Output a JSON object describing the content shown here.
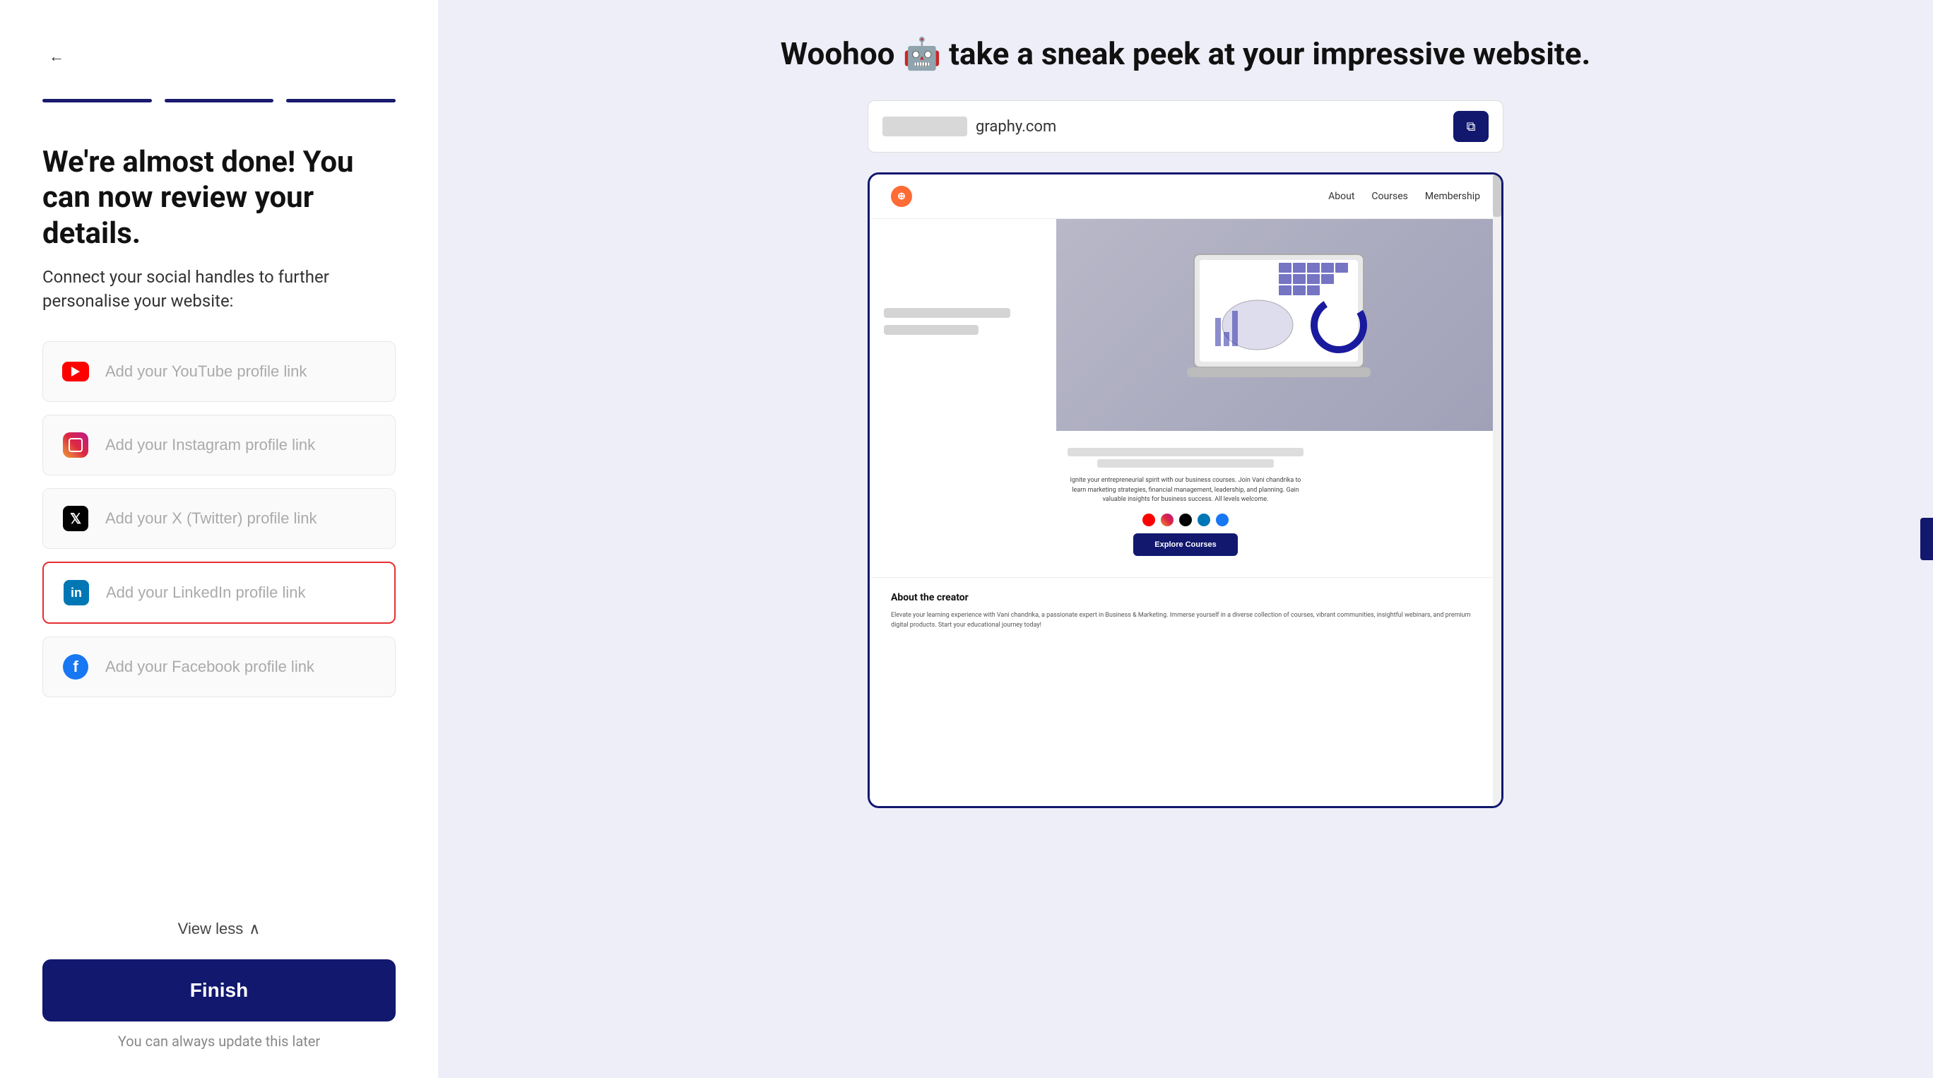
{
  "left": {
    "back_arrow": "←",
    "progress_segments": [
      {
        "active": true
      },
      {
        "active": true
      },
      {
        "active": true
      }
    ],
    "heading": "We're almost done! You can now review your details.",
    "subheading": "Connect your social handles to further personalise your website:",
    "social_items": [
      {
        "id": "youtube",
        "placeholder": "Add your YouTube profile link",
        "highlighted": false,
        "icon_type": "youtube"
      },
      {
        "id": "instagram",
        "placeholder": "Add your Instagram profile link",
        "highlighted": false,
        "icon_type": "instagram"
      },
      {
        "id": "twitter",
        "placeholder": "Add your X (Twitter) profile link",
        "highlighted": false,
        "icon_type": "x"
      },
      {
        "id": "linkedin",
        "placeholder": "Add your LinkedIn profile link",
        "highlighted": true,
        "icon_type": "linkedin"
      },
      {
        "id": "facebook",
        "placeholder": "Add your Facebook profile link",
        "highlighted": false,
        "icon_type": "facebook"
      }
    ],
    "view_less_label": "View less",
    "finish_button_label": "Finish",
    "update_note": "You can always update this later"
  },
  "right": {
    "heading_prefix": "Woohoo",
    "emoji": "🤖",
    "heading_suffix": "take a sneak peek at your impressive website.",
    "browser_url": "graphy.com",
    "copy_icon": "⧉",
    "preview": {
      "nav_items": [
        "About",
        "Courses",
        "Membership"
      ],
      "desc_text": "Ignite your entrepreneurial spirit with our business courses. Join Vani chandrika to learn marketing strategies, financial management, leadership, and planning. Gain valuable insights for business success. All levels welcome.",
      "explore_btn": "Explore Courses",
      "about_title": "About the creator",
      "about_text": "Elevate your learning experience with Vani chandrika, a passionate expert in Business & Marketing. Immerse yourself in a diverse collection of courses, vibrant communities, insightful webinars, and premium digital products. Start your educational journey today!"
    }
  }
}
